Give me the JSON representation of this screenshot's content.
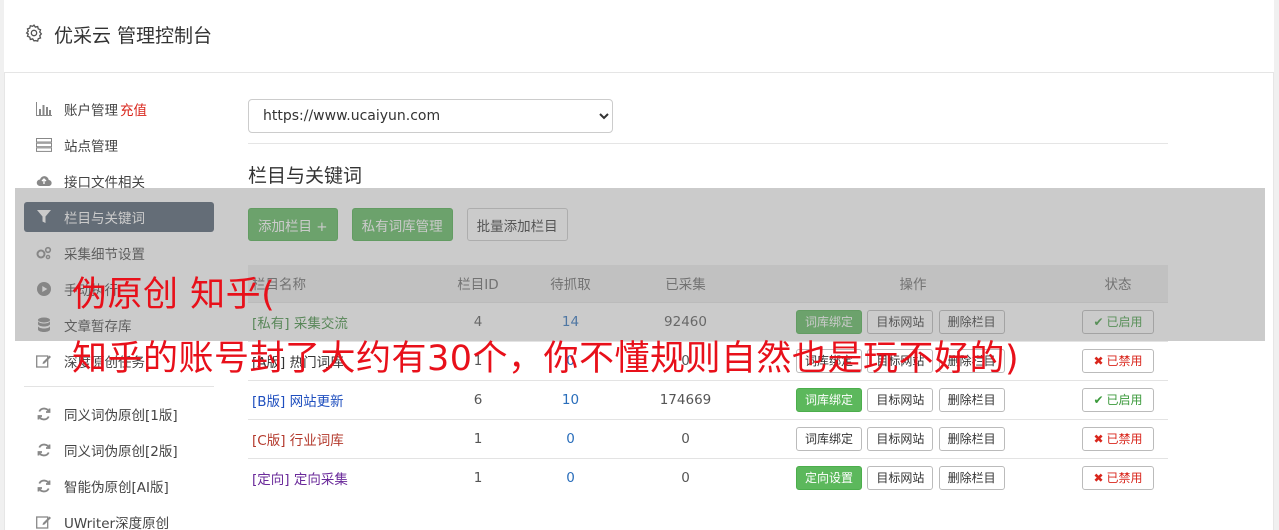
{
  "header": {
    "title": "优采云 管理控制台",
    "icon": "gear-icon"
  },
  "sidebar": {
    "items": [
      {
        "label": "账户管理",
        "extra": "充值",
        "icon": "bar-chart-icon"
      },
      {
        "label": "站点管理",
        "icon": "server-icon"
      },
      {
        "label": "接口文件相关",
        "icon": "cloud-upload-icon"
      },
      {
        "label": "栏目与关键词",
        "icon": "filter-icon",
        "active": true
      },
      {
        "label": "采集细节设置",
        "icon": "cogs-icon"
      },
      {
        "label": "手动执行",
        "icon": "play-circle-icon"
      },
      {
        "label": "文章暂存库",
        "icon": "database-icon"
      },
      {
        "label": "深度原创任务",
        "icon": "edit-icon"
      }
    ],
    "items2": [
      {
        "label": "同义词伪原创[1版]",
        "icon": "refresh-icon"
      },
      {
        "label": "同义词伪原创[2版]",
        "icon": "refresh-icon"
      },
      {
        "label": "智能伪原创[AI版]",
        "icon": "refresh-icon"
      },
      {
        "label": "UWriter深度原创",
        "icon": "edit-icon"
      }
    ]
  },
  "main": {
    "site_select": "https://www.ucaiyun.com",
    "section_title": "栏目与关键词",
    "buttons": {
      "add": "添加栏目 +",
      "private": "私有词库管理",
      "batch": "批量添加栏目"
    },
    "table": {
      "headers": [
        "栏目名称",
        "栏目ID",
        "待抓取",
        "已采集",
        "操作",
        "状态"
      ],
      "rows": [
        {
          "tag": "[私有]",
          "name": "采集交流",
          "id": "4",
          "pending": "14",
          "collected": "92460",
          "op1": "词库绑定",
          "op1_green": true,
          "op2": "目标网站",
          "op3": "删除栏目",
          "status": "已启用",
          "on": true,
          "tag_class": "tag-green"
        },
        {
          "tag": "[A版]",
          "name": "热门词库",
          "id": "1",
          "pending": "0",
          "collected": "0",
          "op1": "词库绑定",
          "op1_green": false,
          "op2": "目标网站",
          "op3": "删除栏目",
          "status": "已禁用",
          "on": false,
          "tag_class": "tag-dark"
        },
        {
          "tag": "[B版]",
          "name": "网站更新",
          "id": "6",
          "pending": "10",
          "collected": "174669",
          "op1": "词库绑定",
          "op1_green": true,
          "op2": "目标网站",
          "op3": "删除栏目",
          "status": "已启用",
          "on": true,
          "tag_class": "tag-blue"
        },
        {
          "tag": "[C版]",
          "name": "行业词库",
          "id": "1",
          "pending": "0",
          "collected": "0",
          "op1": "词库绑定",
          "op1_green": false,
          "op2": "目标网站",
          "op3": "删除栏目",
          "status": "已禁用",
          "on": false,
          "tag_class": "tag-red"
        },
        {
          "tag": "[定向]",
          "name": "定向采集",
          "id": "1",
          "pending": "0",
          "collected": "0",
          "op1": "定向设置",
          "op1_green": true,
          "op2": "目标网站",
          "op3": "删除栏目",
          "status": "已禁用",
          "on": false,
          "tag_class": "tag-purple"
        }
      ]
    }
  },
  "overlay": {
    "line1": "伪原创 知乎(",
    "line2": "知乎的账号封了大约有30个，你不懂规则自然也是玩不好的)"
  },
  "colors": {
    "accent_green": "#5cb85c",
    "active_nav": "#4f5d6e",
    "danger": "#d9261c",
    "overlay_text": "#e8101a"
  }
}
